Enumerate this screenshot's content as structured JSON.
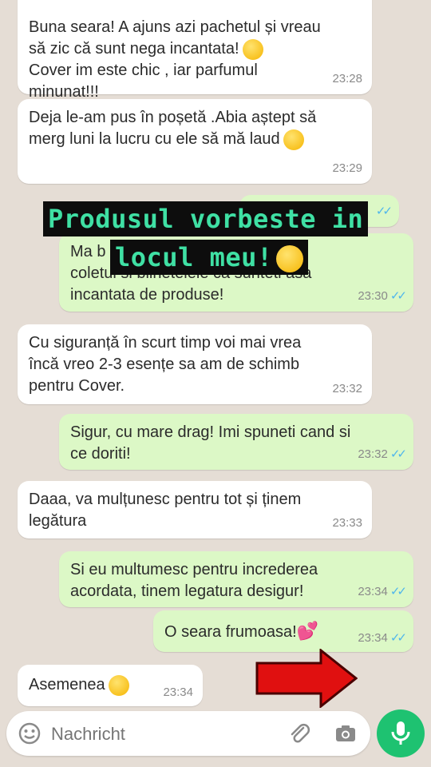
{
  "messages": [
    {
      "dir": "in",
      "text": "Buna seara! A ajuns azi pachetul și vreau\nsă zic că sunt nega incantata!",
      "time": "23:28",
      "text2": "Cover im este chic , iar parfumul\nminunat!!!"
    },
    {
      "dir": "in",
      "text": "Deja le-am pus în poșetă .Abia aștept să\nmerg luni la lucru cu ele să mă laud",
      "time": "23:29"
    },
    {
      "dir": "out",
      "text": "Ma b                                   de\ncoletul si bilnetelele  ca sunteti  asa\nincantata  de produse!",
      "time": "23:30"
    },
    {
      "dir": "in",
      "text": "Cu siguranță în scurt timp voi mai vrea\nîncă vreo 2-3 esențe sa am de schimb\npentru Cover.",
      "time": "23:32"
    },
    {
      "dir": "out",
      "text": "Sigur,  cu mare drag! Imi spuneti  cand si\nce doriti!",
      "time": "23:32"
    },
    {
      "dir": "in",
      "text": "Daaa, va mulțunesc pentru tot și ținem\nlegătura",
      "time": "23:33"
    },
    {
      "dir": "out",
      "text": "Si eu multumesc pentru increderea\nacordata,  tinem legatura desigur!",
      "time": "23:34"
    },
    {
      "dir": "out",
      "text": "O seara frumoasa!",
      "time": "23:34"
    },
    {
      "dir": "in",
      "text": "Asemenea",
      "time": "23:34"
    }
  ],
  "overlay": {
    "line1": "Produsul vorbeste in",
    "line2": "locul meu!"
  },
  "input": {
    "placeholder": "Nachricht"
  },
  "colors": {
    "incoming": "#ffffff",
    "outgoing": "#dcf8c6",
    "overlay_text": "#3fe0a4",
    "send_button": "#1ec271",
    "read_ticks": "#4fb6ec",
    "arrow": "#e01010"
  },
  "icons": [
    "emoji-icon",
    "attach-icon",
    "camera-icon",
    "mic-icon",
    "read-ticks-icon",
    "arrow-icon"
  ]
}
